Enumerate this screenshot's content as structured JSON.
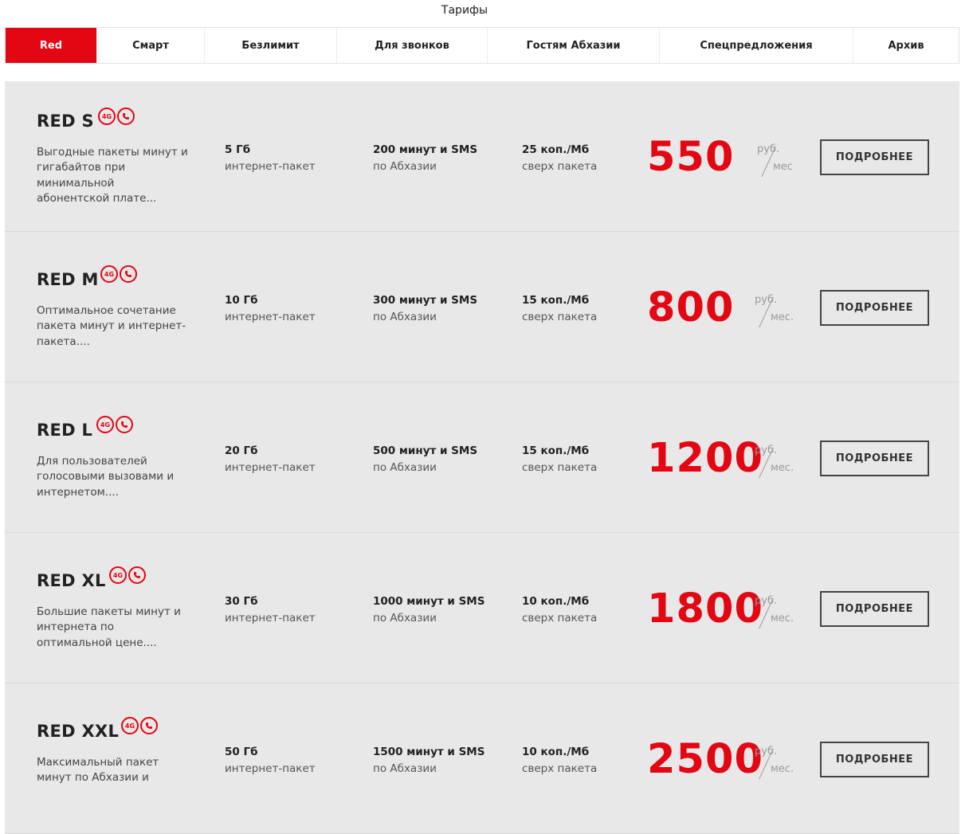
{
  "page": {
    "title": "Тарифы"
  },
  "tabs": [
    {
      "label": "Red"
    },
    {
      "label": "Смарт"
    },
    {
      "label": "Безлимит"
    },
    {
      "label": "Для звонков"
    },
    {
      "label": "Гостям Абхазии"
    },
    {
      "label": "Спецпредложения"
    },
    {
      "label": "Архив"
    }
  ],
  "accent_color": "#e30613",
  "badges": {
    "network": "4G",
    "messenger_icon": "whatsapp-icon"
  },
  "tariffs": [
    {
      "name": "RED S",
      "desc": "Выгодные пакеты минут и гигабайтов при минимальной абонентской плате...",
      "internet_value": "5 Гб",
      "internet_label": "интернет-пакет",
      "minutes_value": "200 минут и SMS",
      "minutes_label": "по Абхазии",
      "extra_value": "25 коп./Мб",
      "extra_label": "сверх пакета",
      "price": "550",
      "cur_top": "руб.",
      "cur_bot": "мес",
      "button": "ПОДРОБНЕЕ"
    },
    {
      "name": "RED M",
      "desc": "Оптимальное сочетание пакета минут и интернет-пакета....",
      "internet_value": "10 Гб",
      "internet_label": "интернет-пакет",
      "minutes_value": "300 минут и SMS",
      "minutes_label": "по Абхазии",
      "extra_value": "15 коп./Мб",
      "extra_label": "сверх пакета",
      "price": "800",
      "cur_top": "руб.",
      "cur_bot": "мес.",
      "button": "ПОДРОБНЕЕ"
    },
    {
      "name": "RED L",
      "desc": "Для пользователей голосовыми вызовами и интернетом....",
      "internet_value": "20 Гб",
      "internet_label": "интернет-пакет",
      "minutes_value": "500 минут и SMS",
      "minutes_label": "по Абхазии",
      "extra_value": "15 коп./Мб",
      "extra_label": "сверх пакета",
      "price": "1200",
      "cur_top": "руб.",
      "cur_bot": "мес.",
      "button": "ПОДРОБНЕЕ"
    },
    {
      "name": "RED XL",
      "desc": "Большие пакеты минут и интернета по оптимальной цене....",
      "internet_value": "30 Гб",
      "internet_label": "интернет-пакет",
      "minutes_value": "1000 минут и SMS",
      "minutes_label": "по Абхазии",
      "extra_value": "10 коп./Мб",
      "extra_label": "сверх пакета",
      "price": "1800",
      "cur_top": "руб.",
      "cur_bot": "мес.",
      "button": "ПОДРОБНЕЕ"
    },
    {
      "name": "RED XXL",
      "desc": "Максимальный пакет минут по Абхазии и",
      "internet_value": "50 Гб",
      "internet_label": "интернет-пакет",
      "minutes_value": "1500 минут и SMS",
      "minutes_label": "по Абхазии",
      "extra_value": "10 коп./Мб",
      "extra_label": "сверх пакета",
      "price": "2500",
      "cur_top": "руб.",
      "cur_bot": "мес.",
      "button": "ПОДРОБНЕЕ"
    }
  ]
}
